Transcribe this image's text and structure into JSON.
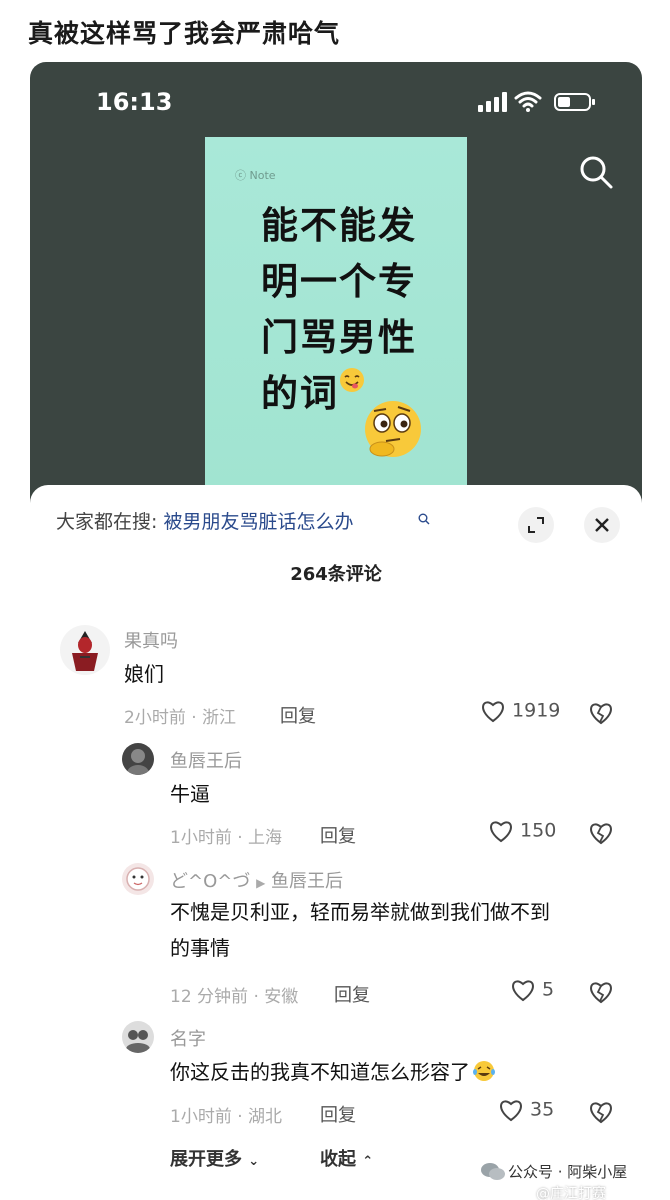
{
  "post": {
    "title": "真被这样骂了我会严肃哈气"
  },
  "status_bar": {
    "time": "16:13"
  },
  "video": {
    "watermark": "ⓒ Note",
    "lines": [
      "能不能发",
      "明一个专",
      "门骂男性",
      "的词"
    ]
  },
  "sheet": {
    "trend_prefix": "大家都在搜:",
    "trend_query": "被男朋友骂脏话怎么办",
    "comment_count": "264条评论",
    "comments": [
      {
        "user": "果真吗",
        "text": "娘们",
        "meta": "2小时前 · 浙江",
        "reply": "回复",
        "likes": "1919"
      },
      {
        "user": "鱼唇王后",
        "text": "牛逼",
        "meta": "1小时前 · 上海",
        "reply": "回复",
        "likes": "150"
      },
      {
        "user": "ど^O^づ",
        "reply_to": "鱼唇王后",
        "text": "不愧是贝利亚，轻而易举就做到我们做不到",
        "text2": "的事情",
        "meta": "12 分钟前 · 安徽",
        "reply": "回复",
        "likes": "5"
      },
      {
        "user": "名字",
        "text": "你这反击的我真不知道怎么形容了",
        "meta": "1小时前 · 湖北",
        "reply": "回复",
        "likes": "35"
      }
    ],
    "expand_more": "展开更多",
    "collapse": "收起"
  },
  "credits": {
    "account": "公众号 · 阿柴小屋",
    "watermark": "@庄江打赛"
  },
  "colors": {
    "phone_bg": "#3b4541",
    "card_bg": "#a9e8d8",
    "accent_link": "#2a4a8c"
  }
}
